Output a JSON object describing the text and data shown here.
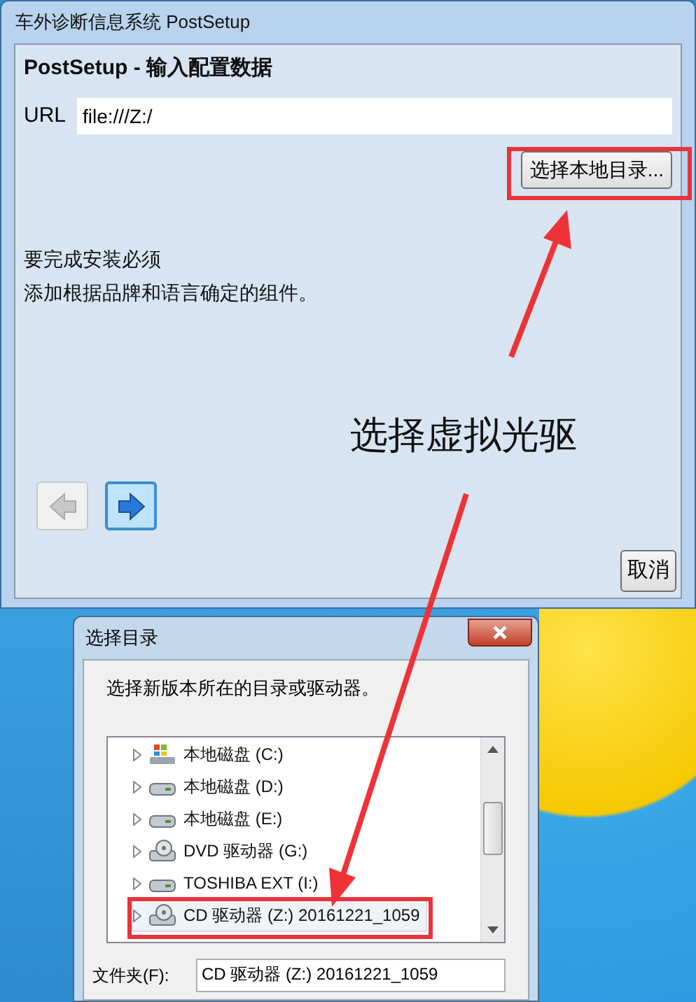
{
  "main_window": {
    "title": "车外诊断信息系统 PostSetup",
    "heading": "PostSetup - 输入配置数据",
    "url_label": "URL",
    "url_value": "file:///Z:/",
    "browse_button": "选择本地目录...",
    "message_lines": [
      "要完成安装必须",
      "添加根据品牌和语言确定的组件。"
    ],
    "back_button": {
      "disabled": true
    },
    "next_button": {
      "disabled": false
    },
    "cancel_button": "取消"
  },
  "annotation": {
    "text": "选择虚拟光驱"
  },
  "folder_dialog": {
    "title": "选择目录",
    "instruction": "选择新版本所在的目录或驱动器。",
    "tree_items": [
      {
        "label": "本地磁盘 (C:)",
        "kind": "system",
        "selected": false
      },
      {
        "label": "本地磁盘 (D:)",
        "kind": "drive",
        "selected": false
      },
      {
        "label": "本地磁盘 (E:)",
        "kind": "drive",
        "selected": false
      },
      {
        "label": "DVD 驱动器 (G:)",
        "kind": "optical",
        "selected": false
      },
      {
        "label": "TOSHIBA EXT (I:)",
        "kind": "drive",
        "selected": false
      },
      {
        "label": "CD 驱动器 (Z:) 20161221_1059",
        "kind": "optical",
        "selected": true
      }
    ],
    "folder_label": "文件夹(F):",
    "folder_value": "CD 驱动器 (Z:) 20161221_1059"
  }
}
